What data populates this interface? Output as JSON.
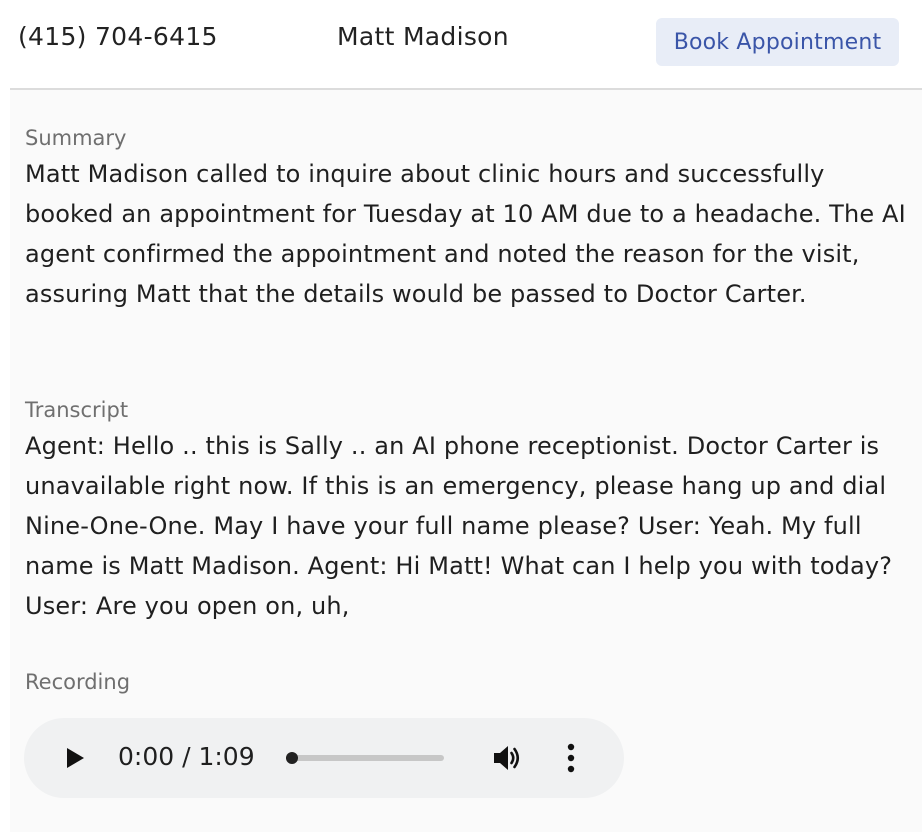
{
  "header": {
    "phone": "(415) 704-6415",
    "name": "Matt Madison",
    "book_button": "Book Appointment"
  },
  "summary": {
    "label": "Summary",
    "text": "Matt Madison called to inquire about clinic hours and successfully booked an appointment for Tuesday at 10 AM due to a headache. The AI agent confirmed the appointment and noted the reason for the visit, assuring Matt that the details would be passed to Doctor Carter."
  },
  "transcript": {
    "label": "Transcript",
    "text": "Agent: Hello .. this is Sally .. an AI phone receptionist. Doctor Carter is unavailable right now. If this is an emergency, please hang up and dial Nine-One-One. May I have your full name please? User: Yeah. My full name is Matt Madison. Agent: Hi Matt! What can I help you with today? User: Are you open on, uh,"
  },
  "recording": {
    "label": "Recording",
    "time_display": "0:00 / 1:09",
    "progress_fraction": 0.04,
    "icons": {
      "play": "play-icon",
      "volume": "volume-icon",
      "more": "more-vertical-icon"
    }
  },
  "colors": {
    "accent": "#3a55a8",
    "button_bg": "#e8edf7",
    "label": "#6f6f6f",
    "panel_bg": "#fafafa"
  }
}
